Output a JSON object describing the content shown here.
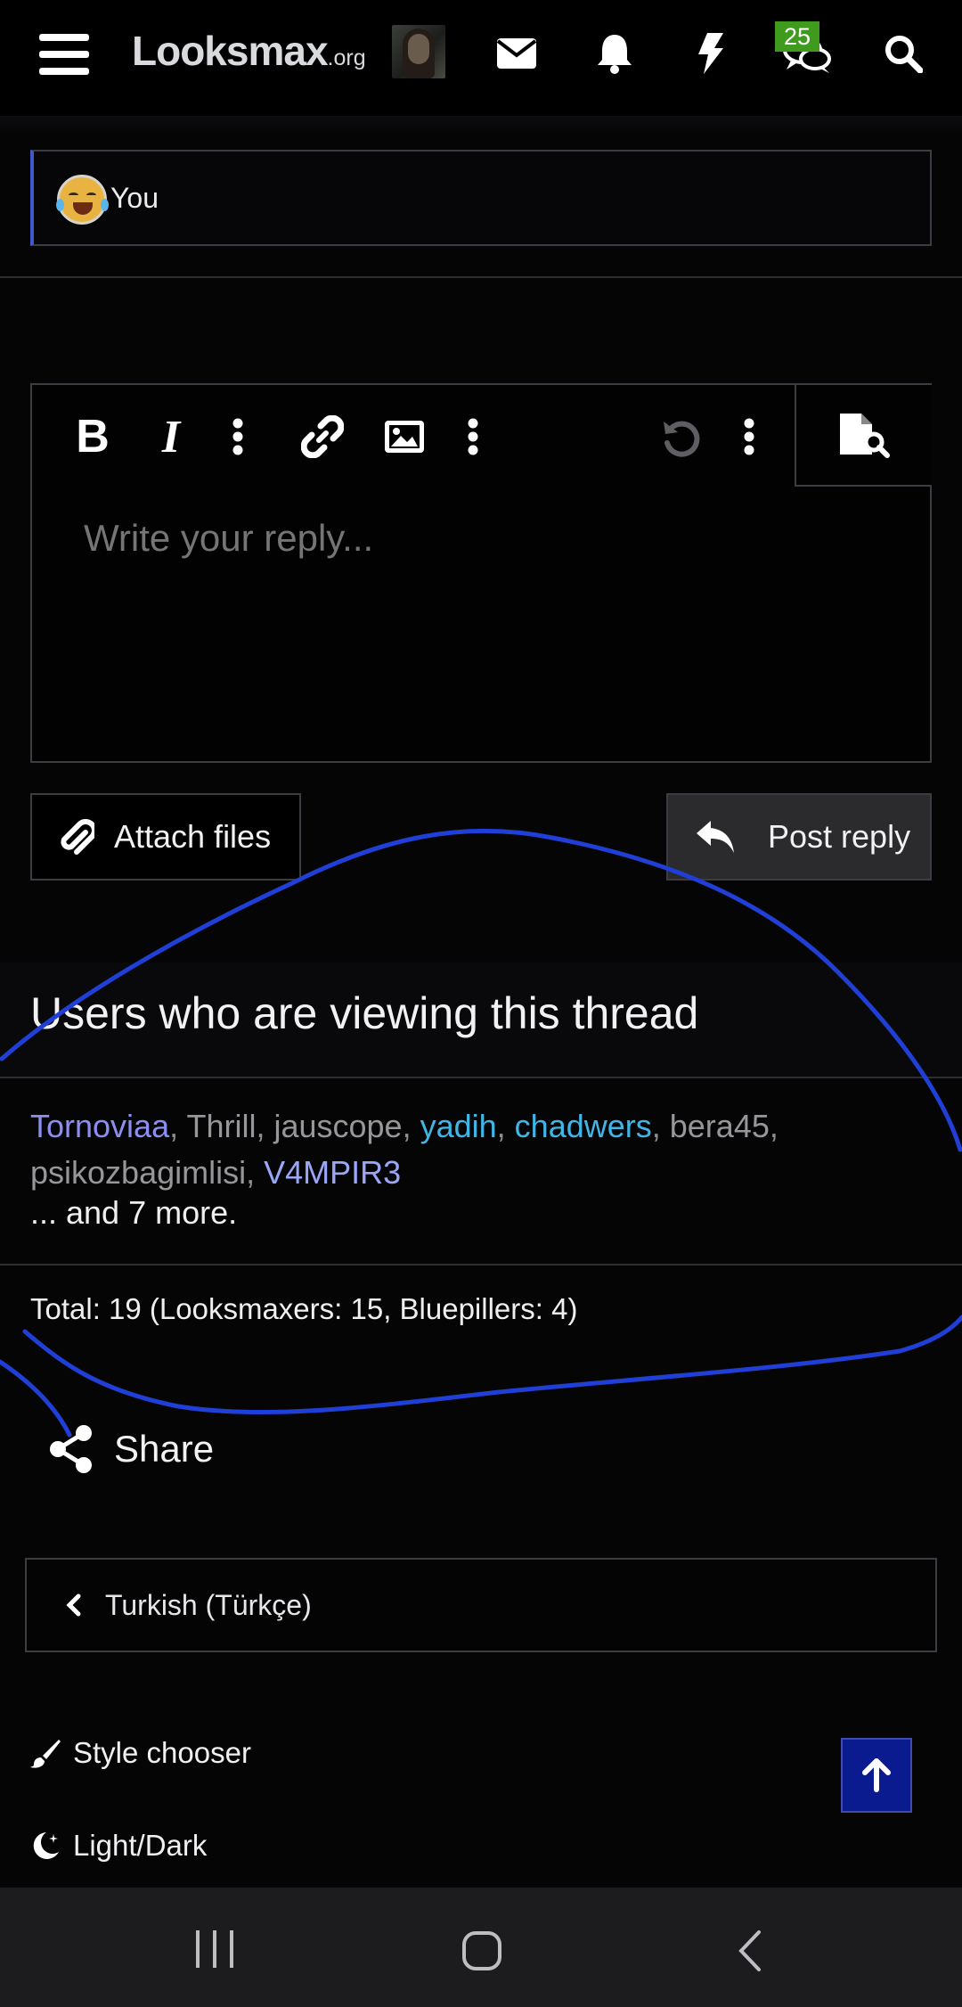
{
  "nav": {
    "logo_main": "Looksmax",
    "logo_tld": ".org",
    "conversations_badge": "25",
    "icons": [
      "menu-icon",
      "avatar",
      "envelope-icon",
      "bell-icon",
      "bolt-icon",
      "conversations-icon",
      "search-icon"
    ]
  },
  "mention": {
    "label": "You",
    "emoji": "face-with-tears-of-joy"
  },
  "editor": {
    "placeholder": "Write your reply...",
    "toolbar": [
      "bold-icon",
      "italic-icon",
      "more-icon",
      "link-icon",
      "image-icon",
      "more-icon",
      "undo-icon",
      "more-icon",
      "preview-icon"
    ]
  },
  "actions": {
    "attach_label": "Attach files",
    "post_label": "Post reply"
  },
  "viewers": {
    "title": "Users who are viewing this thread",
    "users": [
      {
        "name": "Tornoviaa",
        "color": "#8c8ff0"
      },
      {
        "name": "Thrill",
        "color": "#96969b"
      },
      {
        "name": "jauscope",
        "color": "#96969b"
      },
      {
        "name": "yadih",
        "color": "#41b6e6"
      },
      {
        "name": "chadwers",
        "color": "#41b6e6"
      },
      {
        "name": "bera45",
        "color": "#96969b"
      },
      {
        "name": "psikozbagimlisi",
        "color": "#96969b"
      },
      {
        "name": "V4MPIR3",
        "color": "#9aa6f7"
      }
    ],
    "more": "... and 7 more.",
    "total": "Total: 19 (Looksmaxers: 15, Bluepillers: 4)"
  },
  "share": {
    "label": "Share"
  },
  "language": {
    "label": "Turkish (Türkçe)"
  },
  "footer": {
    "style_chooser": "Style chooser",
    "light_dark": "Light/Dark"
  },
  "colors": {
    "accent_bar": "#4158c9",
    "back_top_bg": "#0a1a8f",
    "badge_bg": "#3f9b1d",
    "annotation_stroke": "#1f3fd6"
  }
}
